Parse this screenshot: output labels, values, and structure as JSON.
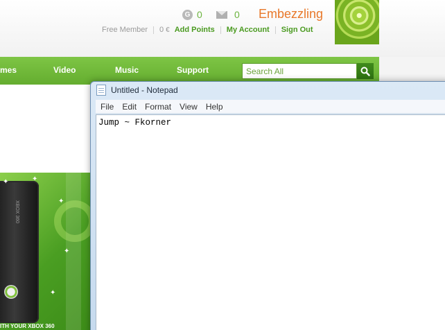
{
  "header": {
    "gold_icon_letter": "G",
    "gold_count": "0",
    "messages_count": "0",
    "gamertag": "Embezzling",
    "membership": "Free Member",
    "points_balance": "0",
    "points_symbol": "€",
    "add_points": "Add Points",
    "my_account": "My Account",
    "sign_out": "Sign Out"
  },
  "nav": {
    "items": [
      "mes",
      "Video",
      "Music",
      "Support"
    ],
    "search_placeholder": "Search All"
  },
  "promo": {
    "console_label": "XBOX 360",
    "caption": "ITH YOUR XBOX 360"
  },
  "notepad": {
    "title": "Untitled - Notepad",
    "menu": [
      "File",
      "Edit",
      "Format",
      "View",
      "Help"
    ],
    "content": "Jump ~ Fkorner"
  },
  "colors": {
    "xbox_green": "#6cb33f",
    "gamertag_orange": "#e8782a",
    "nav_green": "#72b93a"
  }
}
